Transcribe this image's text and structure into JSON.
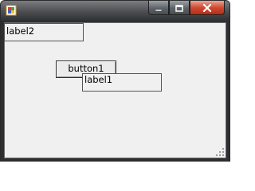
{
  "window": {
    "icon": "winforms-app-icon",
    "caption_buttons": [
      "minimize",
      "maximize",
      "close"
    ]
  },
  "form": {
    "label2": "label2",
    "button1": "button1",
    "label1": "label1"
  },
  "colors": {
    "client_background": "#f0f0f0",
    "close_button": "#c83c24",
    "titlebar": "#2c2e31"
  }
}
